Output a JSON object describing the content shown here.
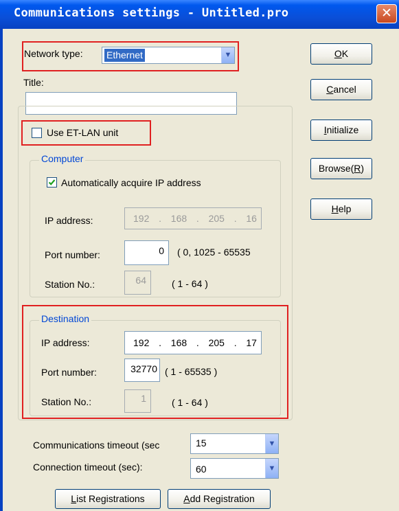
{
  "window": {
    "title": "Communications settings - Untitled.pro",
    "close_glyph": "✕"
  },
  "network_type": {
    "label": "Network type:",
    "value": "Ethernet"
  },
  "title_field": {
    "label": "Title:",
    "value": ""
  },
  "use_et_lan": {
    "label": "Use ET-LAN unit",
    "checked": false
  },
  "computer": {
    "legend": "Computer",
    "auto_ip": {
      "label": "Automatically acquire IP address",
      "checked": true
    },
    "ip": {
      "label": "IP address:",
      "octets": [
        "192",
        "168",
        "205",
        "16"
      ],
      "sep": "."
    },
    "port": {
      "label": "Port number:",
      "value": "0",
      "range": "( 0, 1025 - 65535"
    },
    "station": {
      "label": "Station No.:",
      "value": "64",
      "range": "( 1 - 64 )"
    }
  },
  "destination": {
    "legend": "Destination",
    "ip": {
      "label": "IP address:",
      "octets": [
        "192",
        "168",
        "205",
        "17"
      ],
      "sep": "."
    },
    "port": {
      "label": "Port number:",
      "value": "32770",
      "range": "( 1 - 65535 )"
    },
    "station": {
      "label": "Station No.:",
      "value": "1",
      "range": "( 1 - 64 )"
    }
  },
  "comm_timeout": {
    "label": "Communications timeout (sec",
    "value": "15"
  },
  "conn_timeout": {
    "label": "Connection timeout (sec):",
    "value": "60"
  },
  "buttons": {
    "ok": {
      "mnemonic": "O",
      "rest": "K"
    },
    "cancel": {
      "mnemonic": "C",
      "rest": "ancel"
    },
    "initialize": {
      "mnemonic": "I",
      "rest": "nitialize"
    },
    "browse": {
      "pre": "Browse(",
      "mnemonic": "R",
      "post": ")"
    },
    "help": {
      "mnemonic": "H",
      "rest": "elp"
    },
    "list_registrations": {
      "mnemonic": "L",
      "rest": "ist Registrations"
    },
    "add_registration": {
      "mnemonic": "A",
      "rest": "dd Registration"
    }
  },
  "icons": {
    "combo_arrow": "chevron-down-icon",
    "checkmark": "checkmark-icon"
  }
}
